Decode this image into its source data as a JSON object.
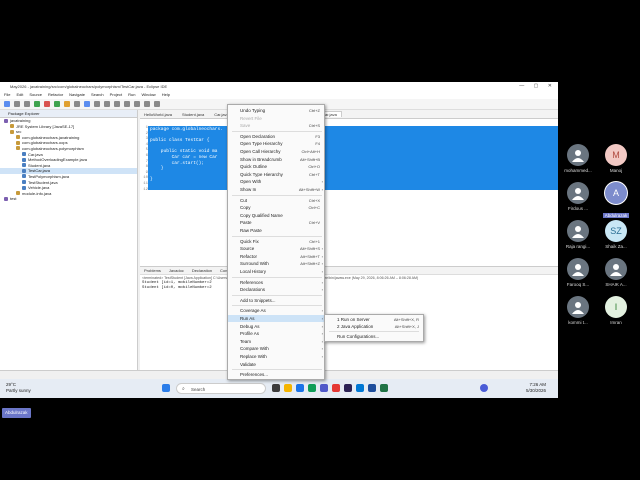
{
  "window": {
    "title": "May2026 - javatraining/src/com/globalneochars/polymorphism/TestCar.java - Eclipse IDE",
    "menu": [
      "File",
      "Edit",
      "Source",
      "Refactor",
      "Navigate",
      "Search",
      "Project",
      "Run",
      "Window",
      "Help"
    ]
  },
  "package_explorer": {
    "title": "Package Explorer",
    "items": [
      {
        "label": "javatraining",
        "indent": 0
      },
      {
        "label": "JRE System Library [JavaSE-17]",
        "indent": 1
      },
      {
        "label": "src",
        "indent": 1
      },
      {
        "label": "com.globalneochars.javatraining",
        "indent": 2
      },
      {
        "label": "com.globalneochars.oops",
        "indent": 2
      },
      {
        "label": "com.globalneochars.polymorphism",
        "indent": 2
      },
      {
        "label": "Car.java",
        "indent": 3
      },
      {
        "label": "MethodOverloadingExample.java",
        "indent": 3
      },
      {
        "label": "Student.java",
        "indent": 3
      },
      {
        "label": "TestCar.java",
        "indent": 3,
        "selected": true
      },
      {
        "label": "TestPolymorphism.java",
        "indent": 3
      },
      {
        "label": "TestStudent.java",
        "indent": 3
      },
      {
        "label": "Vehicle.java",
        "indent": 3
      },
      {
        "label": "module-info.java",
        "indent": 2
      },
      {
        "label": "test",
        "indent": 0
      }
    ]
  },
  "editor": {
    "tabs": [
      "HelloWorld.java",
      "Student.java",
      "Car.java",
      "TestStudent.java",
      "Vehicle.java",
      "TestCar.java"
    ],
    "line_numbers": "1\n2\n3\n4\n5\n6\n7\n8\n9\n10\n11\n12",
    "code": "package com.globalneochars.\n\npublic class TestCar {\n\n    public static void ma\n        Car car = new Car\n        car.start();\n    }\n\n}\n"
  },
  "console": {
    "tabs": [
      "Problems",
      "Javadoc",
      "Declaration",
      "Console"
    ],
    "header": "<terminated> TestStudent [Java Application] C:\\Users\\...\\jdk.hotspot.jre.full.win32.x86_64_17.0.4.v20220903-1038\\jre\\bin\\javaw.exe (May 29, 2026, 8:06:26 AM – 8:06:28 AM)",
    "lines": [
      "Student [id=1, mobileNumber=2",
      "Student [id=0, mobileNumber=2"
    ]
  },
  "status": {
    "insert_mode": "Smart Insert",
    "position": "11 : 1 [162]"
  },
  "context_menu": {
    "items": [
      {
        "label": "Undo Typing",
        "shortcut": "Ctrl+Z"
      },
      {
        "label": "Revert File",
        "shortcut": "",
        "disabled": true
      },
      {
        "label": "Save",
        "shortcut": "Ctrl+S",
        "disabled": true
      },
      {
        "sep": true
      },
      {
        "label": "Open Declaration",
        "shortcut": "F3"
      },
      {
        "label": "Open Type Hierarchy",
        "shortcut": "F4"
      },
      {
        "label": "Open Call Hierarchy",
        "shortcut": "Ctrl+Alt+H"
      },
      {
        "label": "Show in Breadcrumb",
        "shortcut": "Alt+Shift+B"
      },
      {
        "label": "Quick Outline",
        "shortcut": "Ctrl+O"
      },
      {
        "label": "Quick Type Hierarchy",
        "shortcut": "Ctrl+T"
      },
      {
        "label": "Open With",
        "shortcut": "",
        "submenu": true
      },
      {
        "label": "Show In",
        "shortcut": "Alt+Shift+W",
        "submenu": true
      },
      {
        "sep": true
      },
      {
        "label": "Cut",
        "shortcut": "Ctrl+X"
      },
      {
        "label": "Copy",
        "shortcut": "Ctrl+C"
      },
      {
        "label": "Copy Qualified Name",
        "shortcut": ""
      },
      {
        "label": "Paste",
        "shortcut": "Ctrl+V"
      },
      {
        "label": "Raw Paste",
        "shortcut": ""
      },
      {
        "sep": true
      },
      {
        "label": "Quick Fix",
        "shortcut": "Ctrl+1"
      },
      {
        "label": "Source",
        "shortcut": "Alt+Shift+S",
        "submenu": true
      },
      {
        "label": "Refactor",
        "shortcut": "Alt+Shift+T",
        "submenu": true
      },
      {
        "label": "Surround With",
        "shortcut": "Alt+Shift+Z",
        "submenu": true
      },
      {
        "label": "Local History",
        "shortcut": "",
        "submenu": true
      },
      {
        "sep": true
      },
      {
        "label": "References",
        "shortcut": "",
        "submenu": true
      },
      {
        "label": "Declarations",
        "shortcut": "",
        "submenu": true
      },
      {
        "sep": true
      },
      {
        "label": "Add to Snippets...",
        "shortcut": ""
      },
      {
        "sep": true
      },
      {
        "label": "Coverage As",
        "shortcut": "",
        "submenu": true
      },
      {
        "label": "Run As",
        "shortcut": "",
        "submenu": true,
        "highlighted": true
      },
      {
        "label": "Debug As",
        "shortcut": "",
        "submenu": true
      },
      {
        "label": "Profile As",
        "shortcut": "",
        "submenu": true
      },
      {
        "label": "Team",
        "shortcut": "",
        "submenu": true
      },
      {
        "label": "Compare With",
        "shortcut": "",
        "submenu": true
      },
      {
        "label": "Replace With",
        "shortcut": "",
        "submenu": true
      },
      {
        "label": "Validate",
        "shortcut": ""
      },
      {
        "sep": true
      },
      {
        "label": "Preferences...",
        "shortcut": ""
      }
    ]
  },
  "run_as_submenu": {
    "items": [
      {
        "label": "1 Run on Server",
        "shortcut": "Alt+Shift+X, R"
      },
      {
        "label": "2 Java Application",
        "shortcut": "Alt+Shift+X, J"
      },
      {
        "sep": true
      },
      {
        "label": "Run Configurations...",
        "shortcut": ""
      }
    ]
  },
  "taskbar": {
    "weather_temp": "29°C",
    "weather_desc": "Partly sunny",
    "search_placeholder": "Search",
    "time": "7:26 AM",
    "date": "5/30/2026"
  },
  "participants": [
    {
      "name": "mohammed...",
      "initial": "",
      "color": "#6a7580",
      "photo": true
    },
    {
      "name": "Manoj",
      "initial": "M",
      "color": "#f2c9c4",
      "textColor": "#b04a3f"
    },
    {
      "name": "Firdous ...",
      "initial": "",
      "color": "#6a7580",
      "photo": true
    },
    {
      "name": "Abdulrazak",
      "initial": "A",
      "color": "#7d8ccc",
      "highlight": true
    },
    {
      "name": "Raja rangi...",
      "initial": "",
      "color": "#6a7580",
      "photo": true
    },
    {
      "name": "Shaik Za...",
      "initial": "SZ",
      "color": "#c9e7f5",
      "textColor": "#2a6e93"
    },
    {
      "name": "Farooq S...",
      "initial": "",
      "color": "#6a7580",
      "photo": true
    },
    {
      "name": "SHAIK A...",
      "initial": "",
      "color": "#6a7580",
      "photo": true
    },
    {
      "name": "kommi t...",
      "initial": "",
      "color": "#6a7580",
      "photo": true
    },
    {
      "name": "Imran",
      "initial": "I",
      "color": "#e3f1e0",
      "textColor": "#2e7d32"
    }
  ],
  "presenter_tag": "Abdulrazak"
}
